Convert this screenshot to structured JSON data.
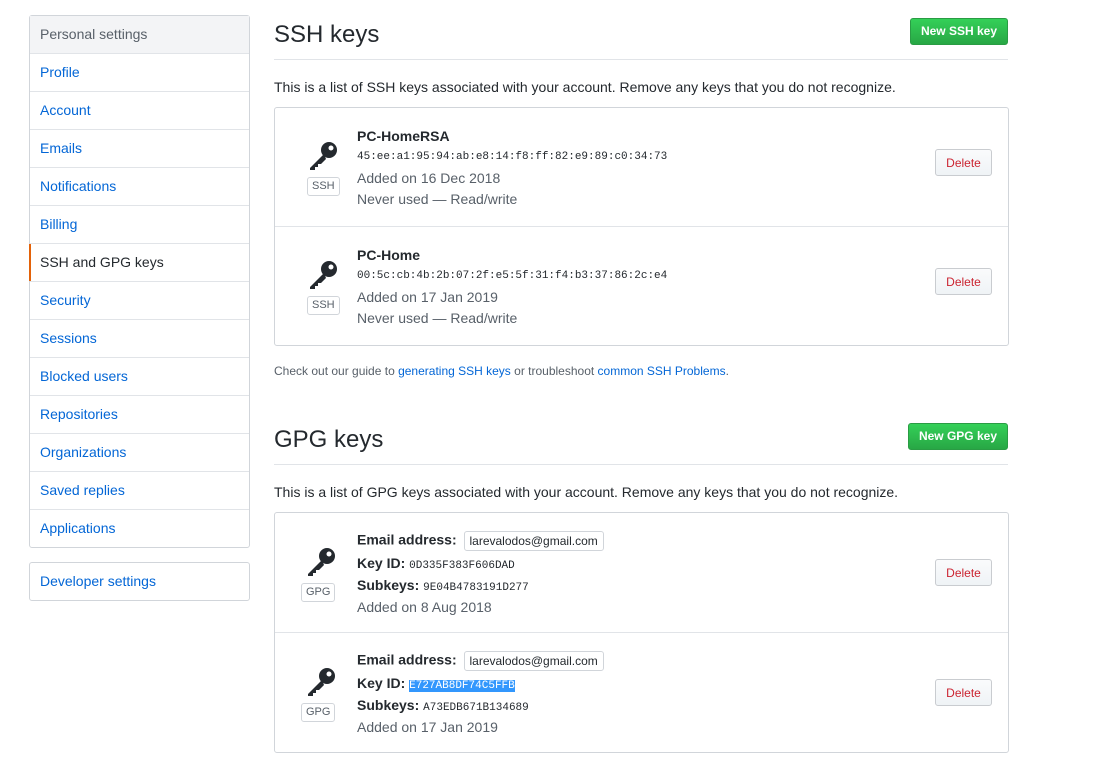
{
  "sidebar": {
    "heading": "Personal settings",
    "items": [
      {
        "label": "Profile"
      },
      {
        "label": "Account"
      },
      {
        "label": "Emails"
      },
      {
        "label": "Notifications"
      },
      {
        "label": "Billing"
      },
      {
        "label": "SSH and GPG keys",
        "selected": true
      },
      {
        "label": "Security"
      },
      {
        "label": "Sessions"
      },
      {
        "label": "Blocked users"
      },
      {
        "label": "Repositories"
      },
      {
        "label": "Organizations"
      },
      {
        "label": "Saved replies"
      },
      {
        "label": "Applications"
      }
    ],
    "developer_settings": "Developer settings"
  },
  "ssh": {
    "title": "SSH keys",
    "new_button": "New SSH key",
    "intro": "This is a list of SSH keys associated with your account. Remove any keys that you do not recognize.",
    "keys": [
      {
        "badge": "SSH",
        "name": "PC-HomeRSA",
        "fingerprint": "45:ee:a1:95:94:ab:e8:14:f8:ff:82:e9:89:c0:34:73",
        "added": "Added on 16 Dec 2018",
        "usage": "Never used — Read/write",
        "delete": "Delete"
      },
      {
        "badge": "SSH",
        "name": "PC-Home",
        "fingerprint": "00:5c:cb:4b:2b:07:2f:e5:5f:31:f4:b3:37:86:2c:e4",
        "added": "Added on 17 Jan 2019",
        "usage": "Never used — Read/write",
        "delete": "Delete"
      }
    ],
    "footnote": {
      "prefix": "Check out our guide to ",
      "link1": "generating SSH keys",
      "middle": " or troubleshoot ",
      "link2": "common SSH Problems",
      "suffix": "."
    }
  },
  "gpg": {
    "title": "GPG keys",
    "new_button": "New GPG key",
    "intro": "This is a list of GPG keys associated with your account. Remove any keys that you do not recognize.",
    "labels": {
      "email": "Email address:",
      "key_id": "Key ID:",
      "subkeys": "Subkeys:"
    },
    "keys": [
      {
        "badge": "GPG",
        "email": "larevalodos@gmail.com",
        "key_id": "0D335F383F606DAD",
        "subkeys": "9E04B4783191D277",
        "added": "Added on 8 Aug 2018",
        "delete": "Delete"
      },
      {
        "badge": "GPG",
        "email": "larevalodos@gmail.com",
        "key_id": "E727AB8DF74C5FFB",
        "subkeys": "A73EDB671B134689",
        "added": "Added on 17 Jan 2019",
        "delete": "Delete"
      }
    ]
  },
  "icons": {
    "key": "key-icon"
  }
}
